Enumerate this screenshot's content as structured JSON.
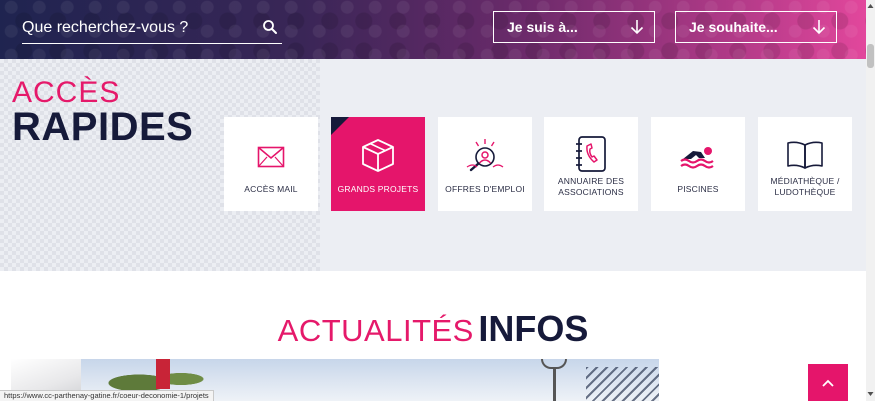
{
  "header": {
    "search_placeholder": "Que recherchez-vous ?",
    "search_value": "",
    "select_1": "Je suis à...",
    "select_2": "Je souhaite..."
  },
  "quick_access": {
    "title_line1": "ACCÈS",
    "title_line2": "RAPIDES",
    "tiles": [
      {
        "label": "ACCÈS MAIL",
        "icon": "mail-icon",
        "active": false
      },
      {
        "label": "GRANDS PROJETS",
        "icon": "box-icon",
        "active": true
      },
      {
        "label": "OFFRES D'EMPLOI",
        "icon": "job-search-icon",
        "active": false
      },
      {
        "label": "ANNUAIRE DES ASSOCIATIONS",
        "icon": "address-book-icon",
        "active": false
      },
      {
        "label": "PISCINES",
        "icon": "swimmer-icon",
        "active": false
      },
      {
        "label": "MÉDIATHÈQUE / LUDOTHÈQUE",
        "icon": "book-icon",
        "active": false
      }
    ]
  },
  "news": {
    "title_light": "ACTUALITÉS",
    "title_bold": "INFOS"
  },
  "status_bar": {
    "url": "https://www.cc-parthenay-gatine.fr/coeur-deconomie-1/projets"
  },
  "colors": {
    "accent": "#e5156b",
    "navy": "#161a3a",
    "band": "#eceef3"
  }
}
